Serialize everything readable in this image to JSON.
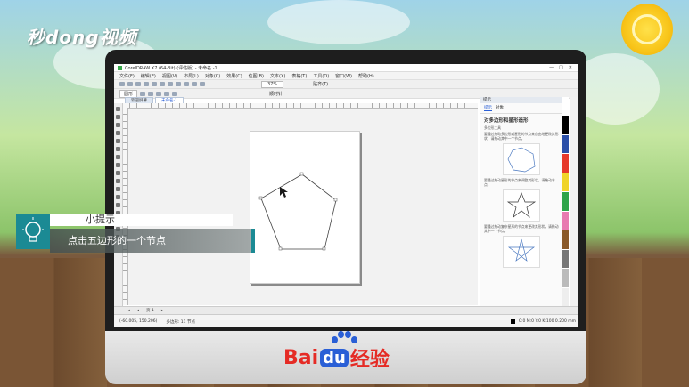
{
  "overlay_logo": "秒dong视频",
  "window": {
    "title": "CorelDRAW X7 (64-Bit) (评估版) - 未命名 -1"
  },
  "menubar": [
    "文件(F)",
    "编辑(E)",
    "视图(V)",
    "布局(L)",
    "对象(C)",
    "效果(C)",
    "位图(B)",
    "文本(X)",
    "表格(T)",
    "工具(O)",
    "窗口(W)",
    "帮助(H)"
  ],
  "toolbar": {
    "zoom": "37%",
    "snap": "贴齐(T)"
  },
  "propbar": {
    "unit": "圆形",
    "object": "顺时针"
  },
  "tabs": [
    {
      "label": "欢迎屏幕"
    },
    {
      "label": "未命名-1"
    }
  ],
  "docker": {
    "header": "提示",
    "tabs": [
      "提示",
      "对象"
    ],
    "section_title": "对多边形和星形造形",
    "item1": "多边形工具",
    "text1": "要通过拖动多边形或星形的节点来自由地更改其形状，请拖动其中一个节点。",
    "text2": "要通过拖动星形的节点来调整其形状，请拖动节点。",
    "text3": "要通过拖动复杂星形的节点来更改其形状，请拖动其中一个节点。"
  },
  "bottom": {
    "page_label": "页 1"
  },
  "status": {
    "coords": "(-60.005, 150.206)",
    "object_info": "多边形: 11 节点",
    "color_info": "C:0 M:0 Y:0 K:100 0.200 mm"
  },
  "overlay": {
    "title": "小提示",
    "subtitle": "点击五边形的一个节点"
  },
  "brand": {
    "bai": "Bai",
    "du": "du",
    "jingyan": "经验"
  },
  "colors": {
    "accent": "#1b8a94",
    "baidu_red": "#e52b25",
    "baidu_blue": "#2a5fd6"
  }
}
